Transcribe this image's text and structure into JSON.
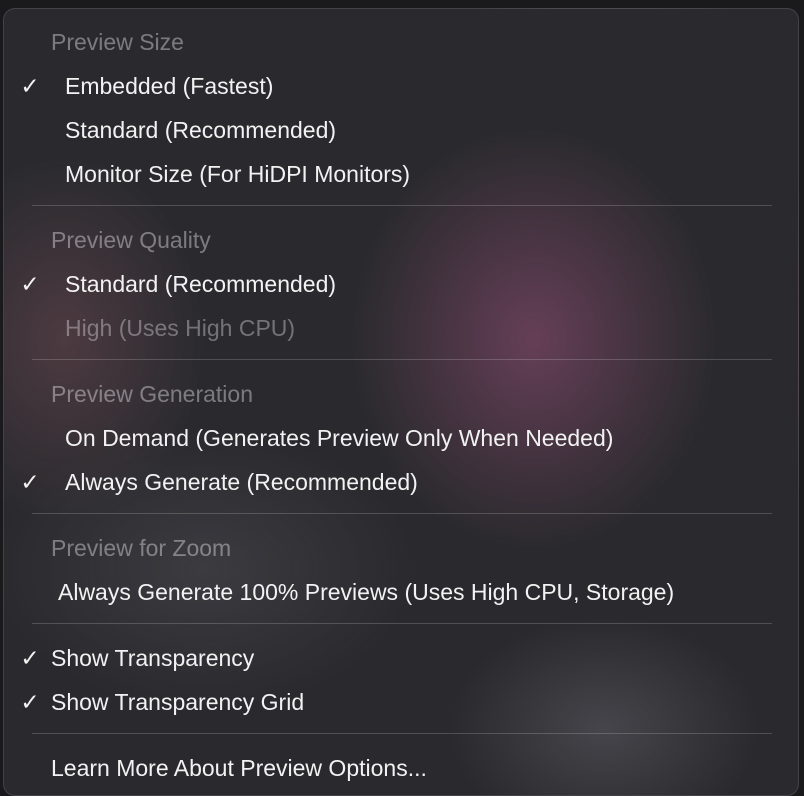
{
  "menu": {
    "preview_size": {
      "header": "Preview Size",
      "items": [
        {
          "label": "Embedded (Fastest)",
          "checked": "✓"
        },
        {
          "label": "Standard (Recommended)",
          "checked": ""
        },
        {
          "label": "Monitor Size (For HiDPI Monitors)",
          "checked": ""
        }
      ]
    },
    "preview_quality": {
      "header": "Preview Quality",
      "items": [
        {
          "label": "Standard (Recommended)",
          "checked": "✓"
        },
        {
          "label": "High (Uses High CPU)",
          "checked": "",
          "disabled": true
        }
      ]
    },
    "preview_generation": {
      "header": "Preview Generation",
      "items": [
        {
          "label": "On Demand (Generates Preview Only When Needed)",
          "checked": ""
        },
        {
          "label": "Always Generate (Recommended)",
          "checked": "✓"
        }
      ]
    },
    "preview_zoom": {
      "header": "Preview for Zoom",
      "items": [
        {
          "label": "Always Generate 100% Previews (Uses High CPU, Storage)",
          "checked": ""
        }
      ]
    },
    "toggles": [
      {
        "label": "Show Transparency",
        "checked": "✓"
      },
      {
        "label": "Show Transparency Grid",
        "checked": "✓"
      }
    ],
    "learn_more": "Learn More About Preview Options..."
  }
}
